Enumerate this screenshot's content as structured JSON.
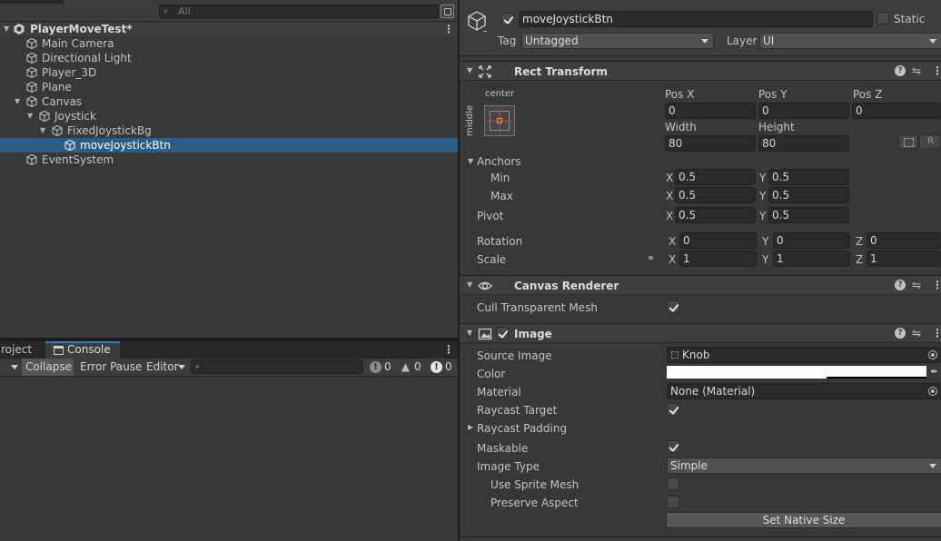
{
  "hierarchy": {
    "search_placeholder": "All",
    "scene_name": "PlayerMoveTest*",
    "items": [
      {
        "label": "Main Camera",
        "depth": 0,
        "expanded": null,
        "selected": false
      },
      {
        "label": "Directional Light",
        "depth": 0,
        "expanded": null,
        "selected": false
      },
      {
        "label": "Player_3D",
        "depth": 0,
        "expanded": null,
        "selected": false
      },
      {
        "label": "Plane",
        "depth": 0,
        "expanded": null,
        "selected": false
      },
      {
        "label": "Canvas",
        "depth": 0,
        "expanded": true,
        "selected": false
      },
      {
        "label": "Joystick",
        "depth": 1,
        "expanded": true,
        "selected": false
      },
      {
        "label": "FixedJoystickBg",
        "depth": 2,
        "expanded": true,
        "selected": false
      },
      {
        "label": "moveJoystickBtn",
        "depth": 3,
        "expanded": null,
        "selected": true
      },
      {
        "label": "EventSystem",
        "depth": 0,
        "expanded": null,
        "selected": false
      }
    ]
  },
  "console": {
    "tab_project": "roject",
    "tab_console": "Console",
    "collapse": "Collapse",
    "error_pause": "Error Pause",
    "editor": "Editor",
    "counts": {
      "info": "0",
      "warning": "0",
      "error": "0"
    }
  },
  "inspector": {
    "name": "moveJoystickBtn",
    "static_label": "Static",
    "tag_label": "Tag",
    "tag_value": "Untagged",
    "layer_label": "Layer",
    "layer_value": "UI",
    "rect_transform": {
      "title": "Rect Transform",
      "anchor_h": "center",
      "anchor_v": "middle",
      "pos_x_label": "Pos X",
      "pos_y_label": "Pos Y",
      "pos_z_label": "Pos Z",
      "pos_x": "0",
      "pos_y": "0",
      "pos_z": "0",
      "width_label": "Width",
      "height_label": "Height",
      "width": "80",
      "height": "80",
      "raw_label": "R",
      "anchors_label": "Anchors",
      "min_label": "Min",
      "max_label": "Max",
      "min_x": "0.5",
      "min_y": "0.5",
      "max_x": "0.5",
      "max_y": "0.5",
      "pivot_label": "Pivot",
      "pivot_x": "0.5",
      "pivot_y": "0.5",
      "rotation_label": "Rotation",
      "rot_x": "0",
      "rot_y": "0",
      "rot_z": "0",
      "scale_label": "Scale",
      "scale_x": "1",
      "scale_y": "1",
      "scale_z": "1",
      "x": "X",
      "y": "Y",
      "z": "Z"
    },
    "canvas_renderer": {
      "title": "Canvas Renderer",
      "cull_label": "Cull Transparent Mesh",
      "cull_value": true
    },
    "image": {
      "title": "Image",
      "source_image_label": "Source Image",
      "source_image": "Knob",
      "color_label": "Color",
      "color_value": "#ffffff",
      "material_label": "Material",
      "material": "None (Material)",
      "raycast_target_label": "Raycast Target",
      "raycast_target": true,
      "raycast_padding_label": "Raycast Padding",
      "maskable_label": "Maskable",
      "maskable": true,
      "image_type_label": "Image Type",
      "image_type": "Simple",
      "use_sprite_mesh_label": "Use Sprite Mesh",
      "use_sprite_mesh": false,
      "preserve_aspect_label": "Preserve Aspect",
      "preserve_aspect": false,
      "set_native_size": "Set Native Size"
    }
  },
  "colors": {
    "selection": "#2c5d87",
    "panel": "#383838",
    "field": "#2a2a2a",
    "accent_tab": "#3a79bb"
  }
}
